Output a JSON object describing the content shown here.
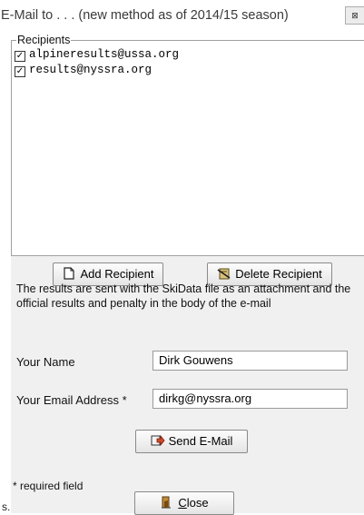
{
  "window": {
    "title": "E-Mail to . . .  (new method as of 2014/15 season)",
    "close_glyph": "⊠",
    "close_icon": "close-icon"
  },
  "recipients": {
    "label": "Recipients",
    "items": [
      {
        "email": "alpineresults@ussa.org",
        "checked": true
      },
      {
        "email": "results@nyssra.org",
        "checked": true
      }
    ]
  },
  "buttons": {
    "add_recipient": "Add Recipient",
    "add_icon": "document-add-icon",
    "delete_recipient": "Delete Recipient",
    "delete_icon": "delete-icon",
    "send_email": "Send E-Mail",
    "send_icon": "send-mail-icon",
    "close_prefix": "C",
    "close_rest": "lose",
    "close_icon": "exit-door-icon"
  },
  "description": "The results are sent with the SkiData file as an attachment and the official results and penalty in the body of the e-mail",
  "form": {
    "name_label": "Your Name",
    "name_value": "Dirk Gouwens",
    "email_label": "Your Email Address *",
    "email_value": "dirkg@nyssra.org"
  },
  "footer": {
    "required_note": "* required field",
    "trailing_text": "s."
  },
  "colors": {
    "panel_bg": "#f0f0f0",
    "button_border": "#8a8a8a",
    "window_bg": "#ffffff"
  }
}
